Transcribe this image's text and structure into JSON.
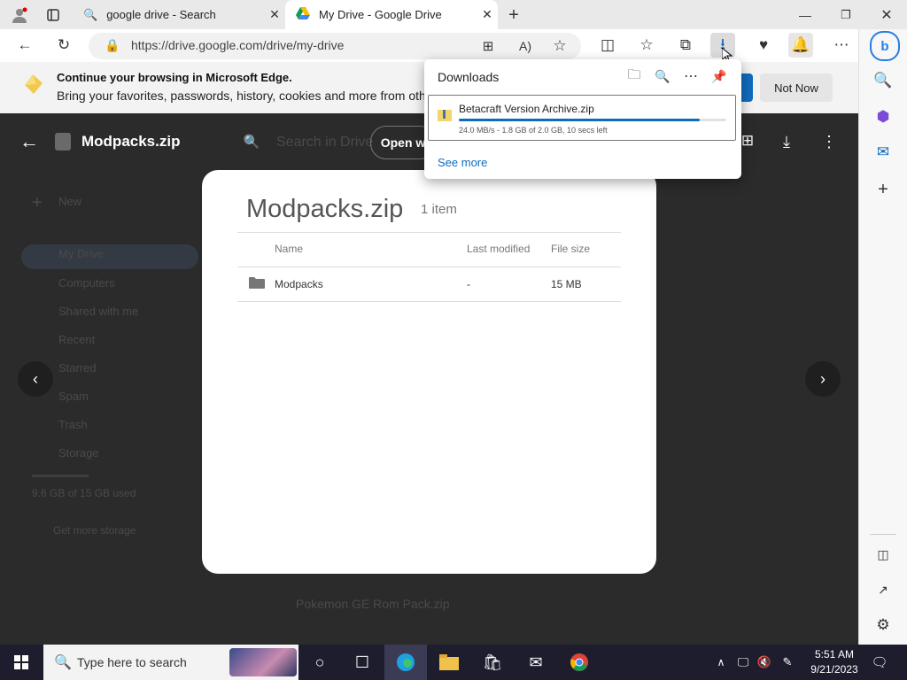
{
  "tabs": [
    {
      "title": "google drive - Search",
      "icon": "search-icon"
    },
    {
      "title": "My Drive - Google Drive",
      "icon": "google-drive-icon"
    }
  ],
  "address": {
    "url": "https://drive.google.com/drive/my-drive"
  },
  "infobar": {
    "title": "Continue your browsing in Microsoft Edge.",
    "subtitle": "Bring your favorites, passwords, history, cookies and more from oth",
    "not_now": "Not Now"
  },
  "drive": {
    "file_name": "Modpacks.zip",
    "search_placeholder": "Search in Drive",
    "open_with": "Open w",
    "sidebar": [
      "New",
      "My Drive",
      "Computers",
      "Shared with me",
      "Recent",
      "Starred",
      "Spam",
      "Trash",
      "Storage"
    ],
    "storage_text": "9.6 GB of 15 GB used",
    "get_storage": "Get more storage",
    "bottom_file": "Pokemon GE Rom Pack.zip"
  },
  "preview": {
    "title": "Modpacks.zip",
    "count": "1 item",
    "columns": {
      "name": "Name",
      "modified": "Last modified",
      "size": "File size"
    },
    "rows": [
      {
        "name": "Modpacks",
        "modified": "-",
        "size": "15 MB"
      }
    ]
  },
  "downloads": {
    "title": "Downloads",
    "item": {
      "name": "Betacraft Version Archive.zip",
      "status": "24.0 MB/s - 1.8 GB of 2.0 GB, 10 secs left",
      "progress": 0.9
    },
    "see_more": "See more"
  },
  "taskbar": {
    "search_placeholder": "Type here to search",
    "time": "5:51 AM",
    "date": "9/21/2023"
  },
  "colors": {
    "accent": "#0f6cbd",
    "dark_overlay": "#2b2b2b"
  }
}
